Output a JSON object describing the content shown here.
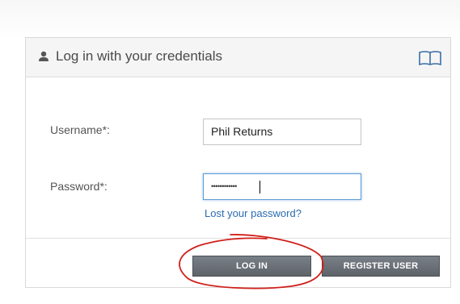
{
  "panel": {
    "title": "Log in with your credentials",
    "user_icon": "user-icon",
    "help_icon": "book-icon"
  },
  "form": {
    "username_label": "Username*:",
    "username_value": "Phil Returns",
    "password_label": "Password*:",
    "password_mask": "••••••••••••",
    "lost_password_link": "Lost your password?"
  },
  "buttons": {
    "login_label": "LOG IN",
    "register_label": "REGISTER USER"
  },
  "colors": {
    "link": "#2a6cb0",
    "button": "#666b72",
    "annotation": "#d0201a",
    "focus": "#5b9bd5"
  }
}
